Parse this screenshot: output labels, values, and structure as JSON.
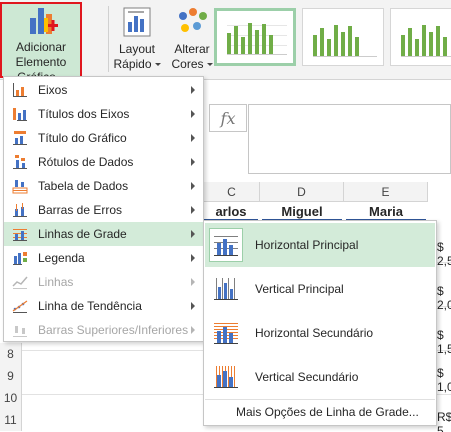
{
  "ribbon": {
    "add_element": {
      "line1": "Adicionar Elemento",
      "line2": "Gráfico"
    },
    "quick_layout": {
      "line1": "Layout",
      "line2": "Rápido"
    },
    "change_colors": {
      "line1": "Alterar",
      "line2": "Cores"
    }
  },
  "formula_bar": {
    "fx_label": "fx"
  },
  "columns": [
    {
      "letter": "C",
      "name": "arlos"
    },
    {
      "letter": "D",
      "name": "Miguel"
    },
    {
      "letter": "E",
      "name": "Maria"
    }
  ],
  "rows": [
    {
      "num": "8",
      "value": "R$ 1,5"
    },
    {
      "num": "9",
      "value": ""
    },
    {
      "num": "10",
      "value": "R$ 1,0"
    },
    {
      "num": "11",
      "value": "R$ 5"
    }
  ],
  "right_values": [
    "$ 2,5",
    "$ 2,0",
    "$ 1,5",
    "$ 1,0",
    "R$ 5"
  ],
  "menu": {
    "items": [
      {
        "label": "Eixos",
        "enabled": true,
        "icon": "axes-icon"
      },
      {
        "label": "Títulos dos Eixos",
        "enabled": true,
        "icon": "axis-titles-icon"
      },
      {
        "label": "Título do Gráfico",
        "enabled": true,
        "icon": "chart-title-icon"
      },
      {
        "label": "Rótulos de Dados",
        "enabled": true,
        "icon": "data-labels-icon"
      },
      {
        "label": "Tabela de Dados",
        "enabled": true,
        "icon": "data-table-icon"
      },
      {
        "label": "Barras de Erros",
        "enabled": true,
        "icon": "error-bars-icon"
      },
      {
        "label": "Linhas de Grade",
        "enabled": true,
        "icon": "gridlines-icon",
        "active": true
      },
      {
        "label": "Legenda",
        "enabled": true,
        "icon": "legend-icon"
      },
      {
        "label": "Linhas",
        "enabled": false,
        "icon": "lines-icon"
      },
      {
        "label": "Linha de Tendência",
        "enabled": true,
        "icon": "trendline-icon"
      },
      {
        "label": "Barras Superiores/Inferiores",
        "enabled": false,
        "icon": "up-down-bars-icon"
      }
    ]
  },
  "submenu": {
    "items": [
      {
        "label": "Horizontal Principal",
        "icon": "horizontal-major-gridlines-icon",
        "active": true
      },
      {
        "label": "Vertical Principal",
        "icon": "vertical-major-gridlines-icon"
      },
      {
        "label": "Horizontal Secundário",
        "icon": "horizontal-minor-gridlines-icon"
      },
      {
        "label": "Vertical Secundário",
        "icon": "vertical-minor-gridlines-icon"
      }
    ],
    "more_options": "Mais Opções de Linha de Grade..."
  },
  "colors": {
    "accent_green": "#70ad47",
    "selected_bg": "#d3ebd9",
    "highlight_red": "#e0161e"
  }
}
